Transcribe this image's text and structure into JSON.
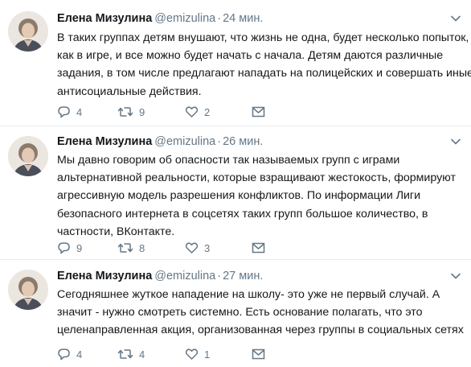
{
  "tweets": [
    {
      "name": "Елена Мизулина",
      "handle": "@emizulina",
      "separator": "·",
      "time": "24 мин.",
      "lines": [
        "В таких группах детям внушают, что жизнь не одна, будет несколько попыток,",
        "как в игре, и все можно будет начать с начала. Детям даются различные",
        "задания, в том числе предлагают нападать на полицейских и совершать иные",
        "антисоциальные действия."
      ],
      "replies": "4",
      "retweets": "9",
      "likes": "2"
    },
    {
      "name": "Елена Мизулина",
      "handle": "@emizulina",
      "separator": "·",
      "time": "26 мин.",
      "lines": [
        "Мы давно говорим об опасности так называемых групп с играми",
        "альтернативной реальности, которые взращивают жестокость, формируют",
        "агрессивную модель разрешения конфликтов. По информации Лиги",
        "безопасного интернета в соцсетях таких групп большое количество, в",
        "частности, ВКонтакте."
      ],
      "replies": "9",
      "retweets": "8",
      "likes": "3"
    },
    {
      "name": "Елена Мизулина",
      "handle": "@emizulina",
      "separator": "·",
      "time": "27 мин.",
      "lines": [
        "Сегодняшнее жуткое нападение на школу- это уже не первый случай. А",
        "значит - нужно смотреть системно. Есть основание полагать, что это",
        "целенаправленная акция, организованная через группы в социальных сетях"
      ],
      "replies": "4",
      "retweets": "4",
      "likes": "1"
    }
  ],
  "icons": {
    "reply": "reply-icon",
    "retweet": "retweet-icon",
    "like": "heart-icon",
    "message": "envelope-icon",
    "more": "chevron-down-icon"
  },
  "colors": {
    "text": "#14171a",
    "muted": "#657786",
    "divider": "#e6ecf0"
  }
}
